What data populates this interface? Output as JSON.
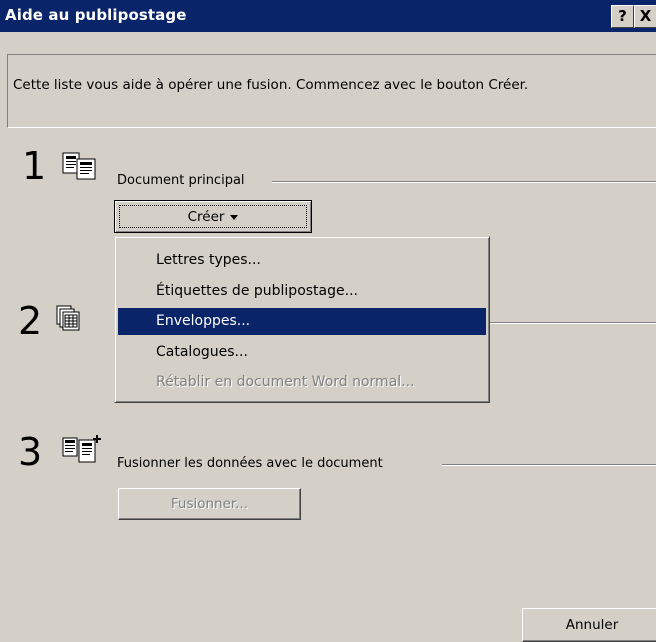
{
  "window": {
    "title": "Aide au publipostage",
    "help_btn": "?",
    "close_btn": "X"
  },
  "info": {
    "text": "Cette liste vous aide à opérer une fusion. Commencez avec le bouton Créer."
  },
  "steps": [
    {
      "number": "1",
      "label": "Document principal",
      "icon": "main-document-icon"
    },
    {
      "number": "2",
      "label": "",
      "icon": "data-source-icon"
    },
    {
      "number": "3",
      "label": "Fusionner les données avec le document",
      "icon": "merge-icon"
    }
  ],
  "buttons": {
    "creer": "Créer",
    "fusionner": "Fusionner...",
    "annuler": "Annuler"
  },
  "menu": {
    "items": [
      {
        "label": "Lettres types...",
        "state": "normal"
      },
      {
        "label": "Étiquettes de publipostage...",
        "state": "normal"
      },
      {
        "label": "Enveloppes...",
        "state": "selected"
      },
      {
        "label": "Catalogues...",
        "state": "normal"
      },
      {
        "label": "Rétablir en document Word normal...",
        "state": "disabled"
      }
    ]
  },
  "colors": {
    "titlebar": "#0a246a",
    "face": "#d4d0c8",
    "highlight": "#0a246a",
    "disabled_text": "#808080"
  }
}
